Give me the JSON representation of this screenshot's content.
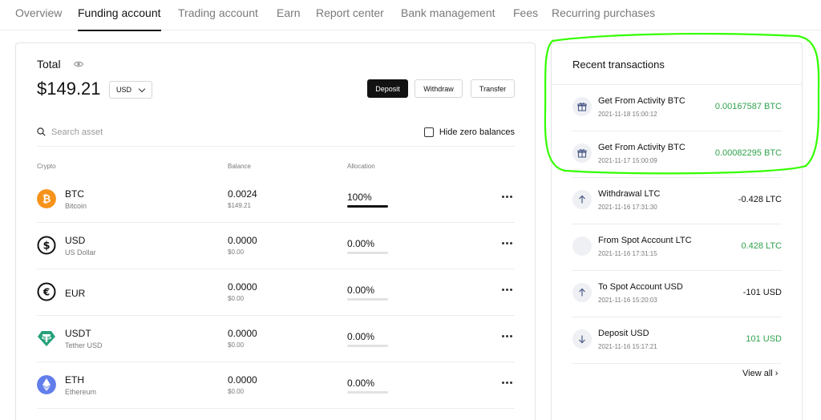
{
  "nav": {
    "tabs": [
      {
        "label": "Overview",
        "active": false
      },
      {
        "label": "Funding account",
        "active": true
      },
      {
        "label": "Trading account",
        "active": false
      },
      {
        "label": "Earn",
        "active": false
      },
      {
        "label": "Report center",
        "active": false
      },
      {
        "label": "Bank management",
        "active": false
      },
      {
        "label": "Fees",
        "active": false
      },
      {
        "label": "Recurring purchases",
        "active": false
      }
    ]
  },
  "summary": {
    "total_label": "Total",
    "total_value": "$149.21",
    "currency": "USD",
    "deposit_label": "Deposit",
    "withdraw_label": "Withdraw",
    "transfer_label": "Transfer"
  },
  "search": {
    "placeholder": "Search asset",
    "hide_zero_label": "Hide zero balances"
  },
  "table": {
    "headers": {
      "crypto": "Crypto",
      "balance": "Balance",
      "allocation": "Allocation"
    },
    "rows": [
      {
        "symbol": "BTC",
        "name": "Bitcoin",
        "balance": "0.0024",
        "balance_usd": "$149.21",
        "allocation": "100%",
        "allocation_fraction": 1.0,
        "icon": "bitcoin-icon",
        "color": "#f7931a"
      },
      {
        "symbol": "USD",
        "name": "US Dollar",
        "balance": "0.0000",
        "balance_usd": "$0.00",
        "allocation": "0.00%",
        "allocation_fraction": 0,
        "icon": "dollar-icon",
        "color": "#121212"
      },
      {
        "symbol": "EUR",
        "name": "",
        "balance": "0.0000",
        "balance_usd": "$0.00",
        "allocation": "0.00%",
        "allocation_fraction": 0,
        "icon": "euro-icon",
        "color": "#121212"
      },
      {
        "symbol": "USDT",
        "name": "Tether USD",
        "balance": "0.0000",
        "balance_usd": "$0.00",
        "allocation": "0.00%",
        "allocation_fraction": 0,
        "icon": "tether-icon",
        "color": "#26a17b"
      },
      {
        "symbol": "ETH",
        "name": "Ethereum",
        "balance": "0.0000",
        "balance_usd": "$0.00",
        "allocation": "0.00%",
        "allocation_fraction": 0,
        "icon": "ethereum-icon",
        "color": "#627eea"
      }
    ]
  },
  "recent": {
    "title": "Recent transactions",
    "view_all": "View all ›",
    "items": [
      {
        "title": "Get From Activity BTC",
        "date": "2021-11-18 15:00:12",
        "amount": "0.00167587 BTC",
        "positive": true,
        "icon": "gift-icon"
      },
      {
        "title": "Get From Activity BTC",
        "date": "2021-11-17 15:00:09",
        "amount": "0.00082295 BTC",
        "positive": true,
        "icon": "gift-icon"
      },
      {
        "title": "Withdrawal LTC",
        "date": "2021-11-16 17:31:30",
        "amount": "-0.428 LTC",
        "positive": false,
        "icon": "arrow-up-icon"
      },
      {
        "title": "From Spot Account LTC",
        "date": "2021-11-16 17:31:15",
        "amount": "0.428 LTC",
        "positive": true,
        "icon": "blank-icon"
      },
      {
        "title": "To Spot Account USD",
        "date": "2021-11-16 15:20:03",
        "amount": "-101 USD",
        "positive": false,
        "icon": "arrow-up-icon"
      },
      {
        "title": "Deposit USD",
        "date": "2021-11-16 15:17:21",
        "amount": "101 USD",
        "positive": true,
        "icon": "arrow-down-icon"
      }
    ]
  },
  "colors": {
    "positive": "#31a24c",
    "highlight": "#33ff00"
  }
}
